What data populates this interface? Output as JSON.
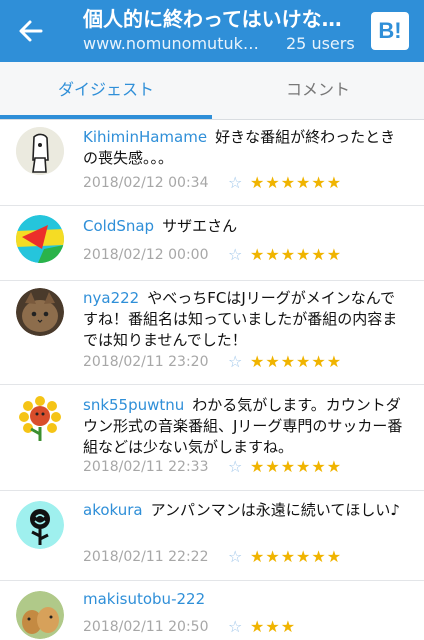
{
  "header": {
    "title": "個人的に終わってはいけな…",
    "subtitle": "www.nomunomutuk…",
    "users": "25 users",
    "b_label": "B!"
  },
  "tabs": [
    {
      "label": "ダイジェスト",
      "active": true
    },
    {
      "label": "コメント",
      "active": false
    }
  ],
  "comments": [
    {
      "username": "KihiminHamame",
      "text": "好きな番組が終わったときの喪失感。。。",
      "timestamp": "2018/02/12 00:34",
      "stars": "★★★★★★",
      "star_count": 6,
      "avatar": "monk-avatar"
    },
    {
      "username": "ColdSnap",
      "text": "サザエさん",
      "timestamp": "2018/02/12 00:00",
      "stars": "★★★★★★",
      "star_count": 6,
      "avatar": "colorful-avatar"
    },
    {
      "username": "nya222",
      "text": "やべっちFCはJリーグがメインなんですね！番組名は知っていましたが番組の内容までは知りませんでした！",
      "timestamp": "2018/02/11 23:20",
      "stars": "★★★★★★",
      "star_count": 6,
      "avatar": "cat-avatar"
    },
    {
      "username": "snk55puwtnu",
      "text": "わかる気がします。カウントダウン形式の音楽番組、Jリーグ専門のサッカー番組などは少ない気がしますね。",
      "timestamp": "2018/02/11 22:33",
      "stars": "★★★★★★",
      "star_count": 6,
      "avatar": "sunflower-avatar"
    },
    {
      "username": "akokura",
      "text": "アンパンマンは永遠に続いてほしい♪",
      "timestamp": "2018/02/11 22:22",
      "stars": "★★★★★★",
      "star_count": 6,
      "avatar": "rose-avatar"
    },
    {
      "username": "makisutobu-222",
      "text": "",
      "timestamp": "2018/02/11 20:50",
      "stars": "★★★",
      "star_count": 3,
      "avatar": "dogs-avatar"
    }
  ],
  "icons": {
    "back": "back-arrow-icon",
    "add_star": "add-star-icon",
    "star": "star-icon"
  },
  "colors": {
    "brand": "#2f8fd8",
    "star": "#f0b400",
    "username": "#2f8fd8",
    "meta": "#a7a7a7"
  }
}
